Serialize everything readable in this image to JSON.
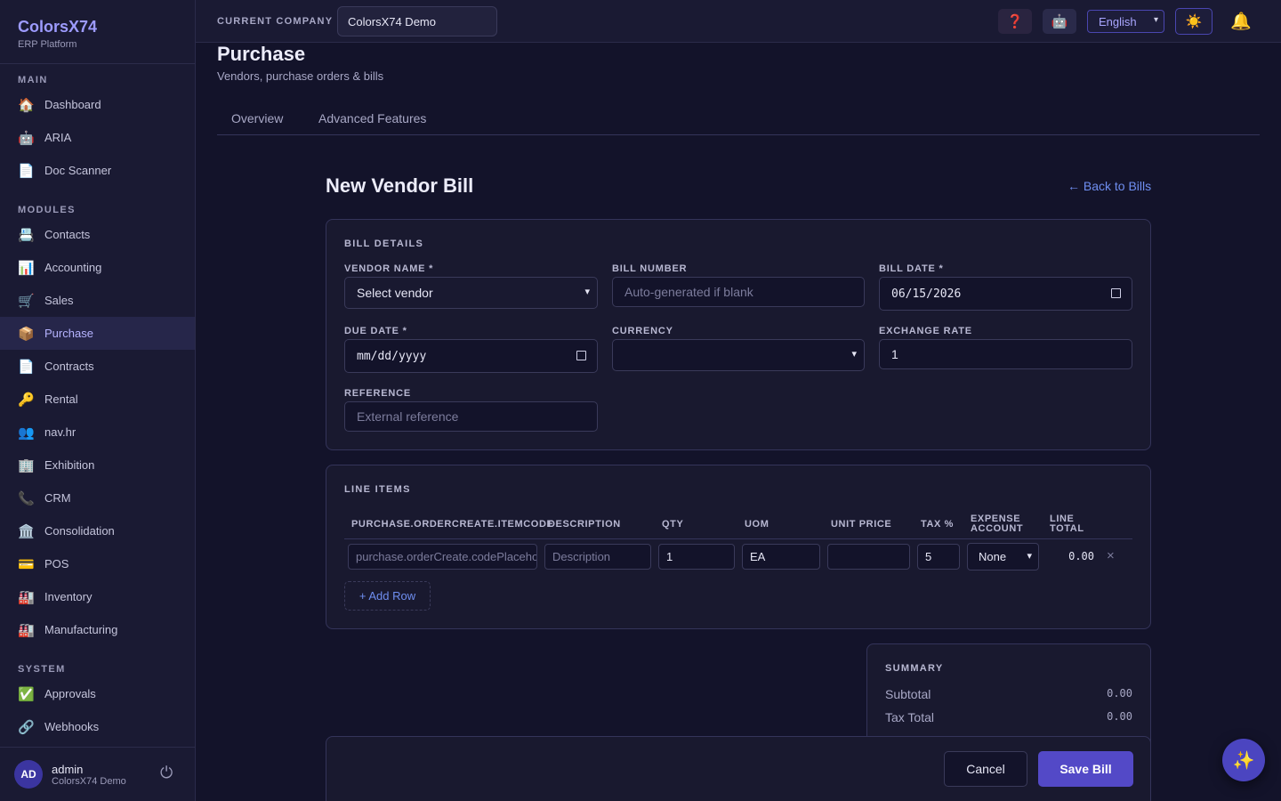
{
  "brand": {
    "name": "ColorsX74",
    "subtitle": "ERP Platform"
  },
  "sidebar": {
    "sections": [
      "MAIN",
      "MODULES",
      "SYSTEM"
    ],
    "main_items": [
      {
        "label": "Dashboard",
        "icon": "🏠"
      },
      {
        "label": "ARIA",
        "icon": "🤖"
      },
      {
        "label": "Doc Scanner",
        "icon": "📄"
      }
    ],
    "module_items": [
      {
        "label": "Contacts",
        "icon": "📇"
      },
      {
        "label": "Accounting",
        "icon": "📊"
      },
      {
        "label": "Sales",
        "icon": "🛒"
      },
      {
        "label": "Purchase",
        "icon": "📦"
      },
      {
        "label": "Contracts",
        "icon": "📄"
      },
      {
        "label": "Rental",
        "icon": "🔑"
      },
      {
        "label": "nav.hr",
        "icon": "👥"
      },
      {
        "label": "Exhibition",
        "icon": "🏢"
      },
      {
        "label": "CRM",
        "icon": "📞"
      },
      {
        "label": "Consolidation",
        "icon": "🏛️"
      },
      {
        "label": "POS",
        "icon": "💳"
      },
      {
        "label": "Inventory",
        "icon": "🏭"
      },
      {
        "label": "Manufacturing",
        "icon": "🏭"
      }
    ],
    "system_items": [
      {
        "label": "Approvals",
        "icon": "✅"
      },
      {
        "label": "Webhooks",
        "icon": "🔗"
      }
    ],
    "active_item": "Purchase"
  },
  "user": {
    "initials": "AD",
    "name": "admin",
    "company": "ColorsX74 Demo",
    "power_icon": "⏻"
  },
  "topbar": {
    "company_label": "CURRENT COMPANY",
    "company_value": "ColorsX74 Demo",
    "help_icon": "❓",
    "bot_icon": "🤖",
    "language": "English",
    "theme_icon": "☀️",
    "bell_icon": "🔔"
  },
  "page": {
    "title": "Purchase",
    "subtitle": "Vendors, purchase orders & bills",
    "tabs": [
      "Overview",
      "Advanced Features"
    ]
  },
  "form": {
    "title": "New Vendor Bill",
    "back_link": "← Back to Bills",
    "bill_details": {
      "section_title": "BILL DETAILS",
      "vendor_label": "VENDOR NAME *",
      "vendor_value": "Select vendor",
      "bill_number_label": "BILL NUMBER",
      "bill_number_placeholder": "Auto-generated if blank",
      "bill_date_label": "BILL DATE *",
      "bill_date_value": "06/15/2026",
      "due_date_label": "DUE DATE *",
      "due_date_value": "mm/dd/yyyy",
      "currency_label": "CURRENCY",
      "currency_value": "",
      "exchange_rate_label": "EXCHANGE RATE",
      "exchange_rate_value": "1",
      "reference_label": "REFERENCE",
      "reference_placeholder": "External reference"
    },
    "line_items": {
      "section_title": "LINE ITEMS",
      "headers": {
        "item_code": "PURCHASE.ORDERCREATE.ITEMCODE",
        "description": "DESCRIPTION",
        "qty": "QTY",
        "uom": "UOM",
        "unit_price": "UNIT PRICE",
        "tax": "TAX %",
        "expense_account": [
          "EXPENSE",
          "ACCOUNT"
        ],
        "line_total": [
          "LINE",
          "TOTAL"
        ]
      },
      "row": {
        "item_code_placeholder": "purchase.orderCreate.codePlaceholder",
        "description_placeholder": "Description",
        "qty": "1",
        "uom": "EA",
        "unit_price": "",
        "tax": "5",
        "expense_account": "None",
        "line_total": "0.00",
        "remove_icon": "×"
      },
      "add_row_label": "+ Add Row"
    },
    "summary": {
      "section_title": "SUMMARY",
      "subtotal_label": "Subtotal",
      "subtotal_value": "0.00",
      "tax_total_label": "Tax Total",
      "tax_total_value": "0.00"
    },
    "actions": {
      "cancel": "Cancel",
      "save": "Save Bill"
    }
  },
  "fab_icon": "✨",
  "colors": {
    "accent": "#5349c7",
    "link": "#6f8ef0",
    "brand": "#9d9bff",
    "background": "#13132a"
  }
}
